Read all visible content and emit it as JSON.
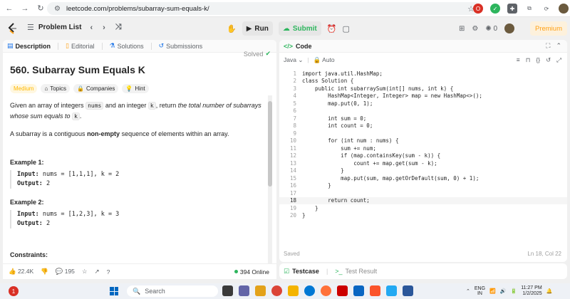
{
  "browser": {
    "url": "leetcode.com/problems/subarray-sum-equals-k/"
  },
  "nav": {
    "problem_list": "Problem List",
    "run": "Run",
    "submit": "Submit",
    "streak": "0",
    "premium": "Premium"
  },
  "left_tabs": [
    "Description",
    "Editorial",
    "Solutions",
    "Submissions"
  ],
  "problem": {
    "title": "560. Subarray Sum Equals K",
    "solved": "Solved",
    "difficulty": "Medium",
    "tags": [
      "Topics",
      "Companies",
      "Hint"
    ],
    "statement_pre": "Given an array of integers ",
    "statement_code1": "nums",
    "statement_mid": " and an integer ",
    "statement_code2": "k",
    "statement_post": ", return ",
    "statement_em": "the total number of subarrays whose sum equals to",
    "statement_code3": "k",
    "statement_end": ".",
    "subarray_pre": "A subarray is a contiguous ",
    "subarray_bold": "non-empty",
    "subarray_post": " sequence of elements within an array.",
    "examples": [
      {
        "title": "Example 1:",
        "input_label": "Input:",
        "input": " nums = [1,1,1], k = 2",
        "output_label": "Output:",
        "output": " 2"
      },
      {
        "title": "Example 2:",
        "input_label": "Input:",
        "input": " nums = [1,2,3], k = 3",
        "output_label": "Output:",
        "output": " 2"
      }
    ],
    "constraints": "Constraints:"
  },
  "footer": {
    "likes": "22.4K",
    "comments": "195",
    "online": "394 Online"
  },
  "code": {
    "header": "Code",
    "language": "Java",
    "mode": "Auto",
    "lines": [
      "import java.util.HashMap;",
      "class Solution {",
      "    public int subarraySum(int[] nums, int k) {",
      "        HashMap<Integer, Integer> map = new HashMap<>();",
      "        map.put(0, 1);",
      "",
      "        int sum = 0;",
      "        int count = 0;",
      "",
      "        for (int num : nums) {",
      "            sum += num;",
      "            if (map.containsKey(sum - k)) {",
      "                count += map.get(sum - k);",
      "            }",
      "            map.put(sum, map.getOrDefault(sum, 0) + 1);",
      "        }",
      "",
      "        return count;",
      "    }",
      "}"
    ],
    "current_line": 18,
    "saved": "Saved",
    "position": "Ln 18, Col 22"
  },
  "bottom": {
    "testcase": "Testcase",
    "result": "Test Result"
  },
  "taskbar": {
    "search": "Search",
    "lang": "ENG",
    "region": "IN",
    "time": "11:27 PM",
    "date": "1/2/2025",
    "badge": "1"
  }
}
